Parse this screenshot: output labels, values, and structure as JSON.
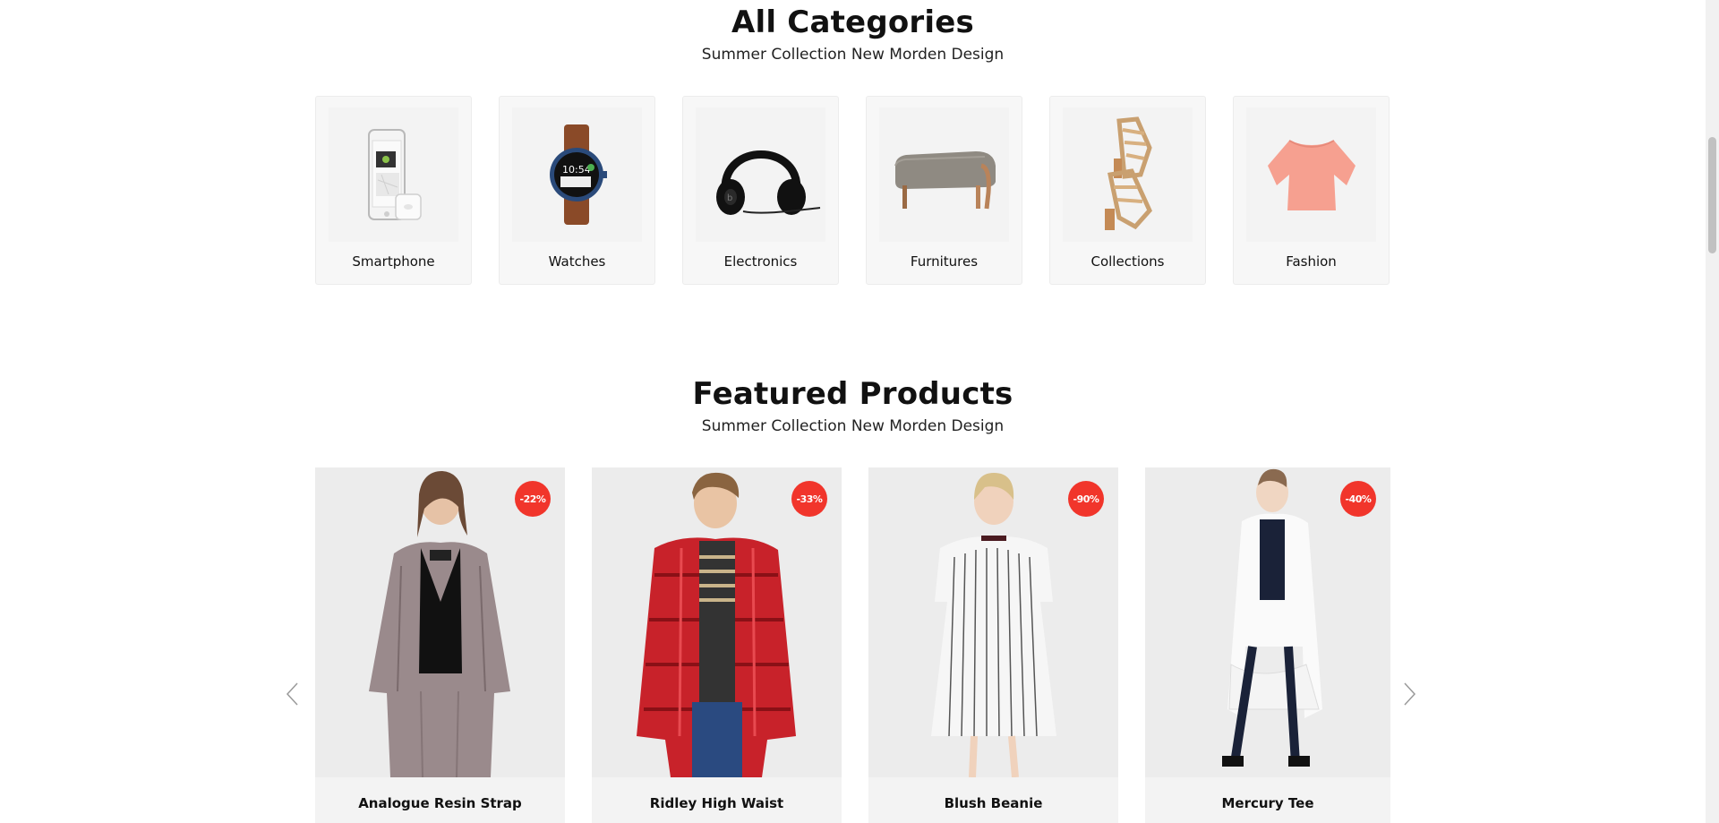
{
  "categories_section": {
    "title": "All Categories",
    "subtitle": "Summer Collection New Morden Design",
    "items": [
      {
        "label": "Smartphone",
        "icon": "smartphone-image"
      },
      {
        "label": "Watches",
        "icon": "watch-image"
      },
      {
        "label": "Electronics",
        "icon": "headphones-image"
      },
      {
        "label": "Furnitures",
        "icon": "ottoman-image"
      },
      {
        "label": "Collections",
        "icon": "sandals-image"
      },
      {
        "label": "Fashion",
        "icon": "blouse-image"
      }
    ]
  },
  "featured_section": {
    "title": "Featured Products",
    "subtitle": "Summer Collection New Morden Design",
    "products": [
      {
        "name": "Analogue Resin Strap",
        "discount": "-22%"
      },
      {
        "name": "Ridley High Waist",
        "discount": "-33%"
      },
      {
        "name": "Blush Beanie",
        "discount": "-90%"
      },
      {
        "name": "Mercury Tee",
        "discount": "-40%"
      }
    ]
  },
  "colors": {
    "badge": "#f1352b",
    "card_background": "#f7f7f7",
    "text": "#111111"
  }
}
